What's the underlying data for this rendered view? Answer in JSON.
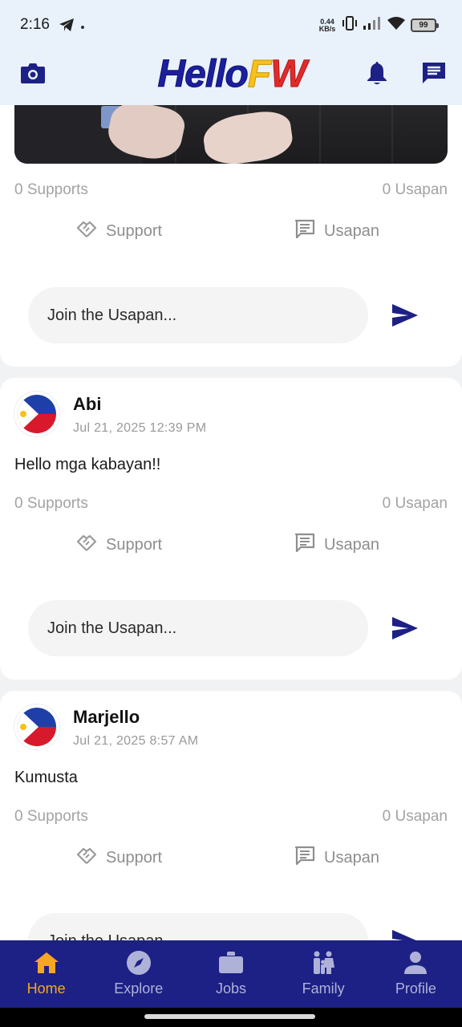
{
  "status_bar": {
    "time": "2:16",
    "net_speed_value": "0.44",
    "net_speed_unit": "KB/s",
    "battery": "99"
  },
  "header": {
    "logo_part1": "Hello",
    "logo_part2": "F",
    "logo_part3": "W",
    "colors": {
      "brand_blue": "#1b1f9e",
      "brand_yellow": "#f6c21a",
      "brand_red": "#e12b2b"
    }
  },
  "posts": [
    {
      "supports": "0 Supports",
      "usapan_count": "0 Usapan",
      "support_label": "Support",
      "usapan_label": "Usapan",
      "comment_placeholder": "Join the Usapan..."
    },
    {
      "author": "Abi",
      "timestamp": "Jul 21, 2025 12:39 PM",
      "text": "Hello mga kabayan!!",
      "supports": "0 Supports",
      "usapan_count": "0 Usapan",
      "support_label": "Support",
      "usapan_label": "Usapan",
      "comment_placeholder": "Join the Usapan..."
    },
    {
      "author": "Marjello",
      "timestamp": "Jul 21, 2025 8:57 AM",
      "text": "Kumusta",
      "supports": "0 Supports",
      "usapan_count": "0 Usapan",
      "support_label": "Support",
      "usapan_label": "Usapan",
      "comment_placeholder": "Join the Usapan..."
    }
  ],
  "bottom_nav": {
    "items": [
      {
        "label": "Home",
        "icon": "home-icon",
        "active": true
      },
      {
        "label": "Explore",
        "icon": "compass-icon",
        "active": false
      },
      {
        "label": "Jobs",
        "icon": "briefcase-icon",
        "active": false
      },
      {
        "label": "Family",
        "icon": "family-icon",
        "active": false
      },
      {
        "label": "Profile",
        "icon": "person-icon",
        "active": false
      }
    ],
    "colors": {
      "background": "#1d2085",
      "active": "#f5a623",
      "inactive": "#aeb2d8"
    }
  }
}
